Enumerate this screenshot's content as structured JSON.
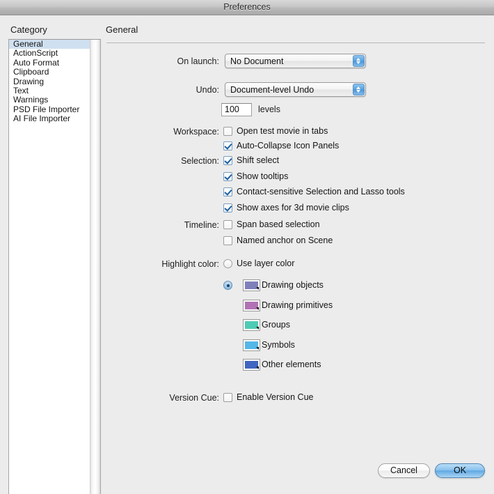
{
  "window": {
    "title": "Preferences"
  },
  "sidebar": {
    "header": "Category",
    "items": [
      {
        "label": "General",
        "selected": true
      },
      {
        "label": "ActionScript",
        "selected": false
      },
      {
        "label": "Auto Format",
        "selected": false
      },
      {
        "label": "Clipboard",
        "selected": false
      },
      {
        "label": "Drawing",
        "selected": false
      },
      {
        "label": "Text",
        "selected": false
      },
      {
        "label": "Warnings",
        "selected": false
      },
      {
        "label": "PSD File Importer",
        "selected": false
      },
      {
        "label": "AI File Importer",
        "selected": false
      }
    ]
  },
  "pane": {
    "title": "General",
    "on_launch": {
      "label": "On launch:",
      "value": "No Document"
    },
    "undo": {
      "label": "Undo:",
      "value": "Document-level Undo"
    },
    "undo_levels": {
      "value": "100",
      "unit": "levels"
    },
    "workspace": {
      "label": "Workspace:",
      "items": [
        {
          "label": "Open test movie in tabs",
          "checked": false
        },
        {
          "label": "Auto-Collapse Icon Panels",
          "checked": true
        }
      ]
    },
    "selection": {
      "label": "Selection:",
      "items": [
        {
          "label": "Shift select",
          "checked": true
        },
        {
          "label": "Show tooltips",
          "checked": true
        },
        {
          "label": "Contact-sensitive Selection and Lasso tools",
          "checked": true
        },
        {
          "label": "Show axes for 3d movie clips",
          "checked": true
        }
      ]
    },
    "timeline": {
      "label": "Timeline:",
      "items": [
        {
          "label": "Span based selection",
          "checked": false
        },
        {
          "label": "Named anchor on Scene",
          "checked": false
        }
      ]
    },
    "highlight_color": {
      "label": "Highlight color:",
      "use_layer_color": {
        "label": "Use layer color",
        "selected": false
      },
      "custom_selected": true,
      "swatches": [
        {
          "label": "Drawing objects",
          "color": "#7f7fbb"
        },
        {
          "label": "Drawing primitives",
          "color": "#b072b5"
        },
        {
          "label": "Groups",
          "color": "#4ecbb4"
        },
        {
          "label": "Symbols",
          "color": "#55b6e8"
        },
        {
          "label": "Other elements",
          "color": "#3f66c0"
        }
      ]
    },
    "version_cue": {
      "label": "Version Cue:",
      "items": [
        {
          "label": "Enable Version Cue",
          "checked": false
        }
      ]
    }
  },
  "footer": {
    "cancel_label": "Cancel",
    "ok_label": "OK"
  }
}
